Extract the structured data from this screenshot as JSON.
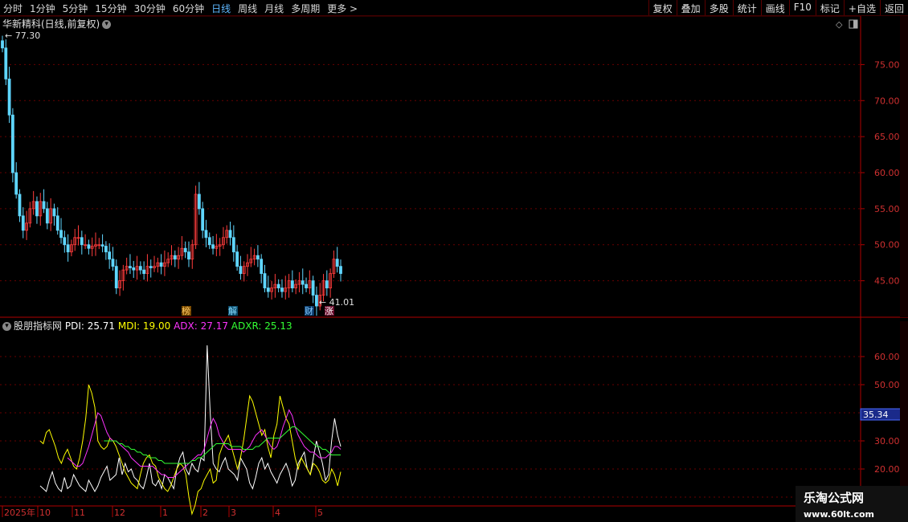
{
  "toolbar": {
    "periods": [
      "分时",
      "1分钟",
      "5分钟",
      "15分钟",
      "30分钟",
      "60分钟",
      "日线",
      "周线",
      "月线",
      "多周期",
      "更多"
    ],
    "active_period": "日线",
    "right_buttons": [
      "复权",
      "叠加",
      "多股",
      "统计",
      "画线",
      "F10",
      "标记",
      "+自选",
      "返回"
    ]
  },
  "main_chart": {
    "title": "华新精科(日线,前复权)",
    "high_label": "77.30",
    "low_label": "41.01",
    "y_ticks": [
      "75.00",
      "70.00",
      "65.00",
      "60.00",
      "55.00",
      "50.00",
      "45.00"
    ],
    "event_markers": [
      "榜",
      "解",
      "财",
      "涨"
    ],
    "up_color": "#ff3c3c",
    "down_color": "#5fd6ff"
  },
  "indicator": {
    "name": "股朋指标网",
    "pdi_label": "PDI: 25.71",
    "mdi_label": "MDI: 19.00",
    "adx_label": "ADX: 27.17",
    "adxr_label": "ADXR: 25.13",
    "y_ticks": [
      "60.00",
      "50.00",
      "40.00",
      "30.00",
      "20.00"
    ],
    "cursor_value": "35.34"
  },
  "time_axis": {
    "labels": [
      "2025年",
      "10",
      "11",
      "12",
      "1",
      "2",
      "3",
      "4",
      "5"
    ]
  },
  "watermark": {
    "title": "乐淘公式网",
    "url": "www.60lt.com"
  },
  "chart_data": {
    "type": "line",
    "price": {
      "closes": [
        77.3,
        73,
        68,
        60,
        57,
        54,
        52,
        53,
        55,
        56,
        54,
        56,
        55,
        53,
        55,
        54,
        52,
        51,
        50,
        49,
        50,
        51,
        51,
        50,
        50,
        49.5,
        49.8,
        50,
        50,
        49.8,
        49,
        48,
        47,
        44,
        45,
        46.5,
        47,
        46.8,
        46.5,
        47,
        46.5,
        46,
        47,
        46.8,
        47,
        47.5,
        47,
        47.5,
        48,
        48.5,
        48,
        48.5,
        49.5,
        49,
        48,
        50,
        57,
        55,
        52,
        51,
        50,
        49.5,
        49.8,
        50,
        51,
        52,
        51,
        49,
        47,
        46,
        47,
        47.5,
        48,
        48.5,
        48,
        46,
        44,
        43.5,
        44,
        44.5,
        44,
        43.5,
        44,
        45,
        44,
        44.5,
        45,
        44.5,
        44,
        45,
        43,
        41.5,
        43,
        45,
        44,
        46,
        48,
        47,
        46
      ],
      "ylim": [
        40.5,
        79.5
      ]
    },
    "series": [
      {
        "name": "PDI",
        "color": "#ffffff",
        "values": [
          14,
          13,
          12,
          16,
          19,
          15,
          13,
          12,
          17,
          13,
          14,
          18,
          16,
          14,
          13,
          12,
          16,
          14,
          12,
          14,
          17,
          19,
          21,
          16,
          17,
          18,
          24,
          18,
          22,
          19,
          20,
          17,
          16,
          14,
          13,
          17,
          22,
          15,
          14,
          16,
          13,
          18,
          17,
          15,
          13,
          20,
          24,
          26,
          20,
          18,
          22,
          20,
          19,
          24,
          23,
          64,
          40,
          22,
          20,
          19,
          22,
          24,
          20,
          19,
          18,
          16,
          24,
          22,
          20,
          15,
          13,
          17,
          22,
          24,
          20,
          22,
          19,
          17,
          15,
          18,
          20,
          22,
          19,
          14,
          16,
          22,
          24,
          26,
          20,
          18,
          24,
          30,
          26,
          22,
          16,
          18,
          30,
          38,
          32,
          28
        ]
      },
      {
        "name": "MDI",
        "color": "#ffff00",
        "values": [
          30,
          29,
          33,
          34,
          31,
          28,
          24,
          22,
          25,
          27,
          24,
          21,
          20,
          24,
          30,
          38,
          50,
          47,
          42,
          30,
          28,
          27,
          28,
          31,
          30,
          28,
          25,
          22,
          19,
          17,
          15,
          14,
          13,
          18,
          22,
          24,
          25,
          22,
          21,
          17,
          15,
          13,
          12,
          14,
          17,
          20,
          22,
          21,
          18,
          10,
          4,
          7,
          12,
          13,
          16,
          18,
          20,
          15,
          16,
          25,
          28,
          30,
          32,
          28,
          24,
          20,
          24,
          30,
          38,
          46,
          44,
          40,
          36,
          32,
          34,
          28,
          24,
          32,
          36,
          46,
          42,
          38,
          36,
          30,
          24,
          20,
          24,
          22,
          20,
          18,
          22,
          21,
          19,
          16,
          15,
          16,
          20,
          18,
          14,
          19
        ]
      },
      {
        "name": "ADX",
        "color": "#ff33ff",
        "values": [
          null,
          null,
          null,
          null,
          null,
          null,
          null,
          null,
          null,
          24,
          23,
          22,
          21,
          21,
          22,
          25,
          28,
          32,
          36,
          40,
          39,
          36,
          33,
          31,
          30,
          30,
          29,
          28,
          27,
          26,
          24,
          23,
          22,
          21,
          21,
          21,
          21,
          21,
          20,
          19,
          18,
          18,
          17,
          17,
          17,
          18,
          19,
          20,
          21,
          22,
          23,
          24,
          25,
          25,
          27,
          31,
          35,
          38,
          36,
          32,
          30,
          28,
          27,
          27,
          27,
          27,
          27,
          26,
          27,
          28,
          30,
          32,
          33,
          34,
          32,
          30,
          28,
          27,
          28,
          31,
          35,
          38,
          41,
          39,
          35,
          32,
          30,
          28,
          27,
          26,
          26,
          25,
          24,
          24,
          24,
          25,
          26,
          28,
          28,
          27
        ]
      },
      {
        "name": "ADXR",
        "color": "#33ff33",
        "values": [
          null,
          null,
          null,
          null,
          null,
          null,
          null,
          null,
          null,
          null,
          null,
          null,
          null,
          null,
          null,
          null,
          null,
          null,
          null,
          null,
          null,
          30,
          30,
          30,
          30,
          30,
          29,
          29,
          28,
          28,
          27,
          27,
          26,
          26,
          25,
          25,
          24,
          24,
          24,
          23,
          23,
          22,
          22,
          22,
          22,
          22,
          22,
          22,
          22,
          22,
          23,
          23,
          24,
          24,
          25,
          26,
          27,
          28,
          29,
          29,
          29,
          29,
          29,
          28,
          28,
          28,
          28,
          27,
          27,
          27,
          27,
          28,
          28,
          29,
          30,
          31,
          31,
          31,
          31,
          31,
          32,
          33,
          34,
          35,
          35,
          34,
          33,
          32,
          31,
          30,
          29,
          28,
          28,
          27,
          27,
          26,
          25,
          25,
          25,
          25
        ]
      }
    ],
    "ylim": [
      8,
      72
    ]
  }
}
